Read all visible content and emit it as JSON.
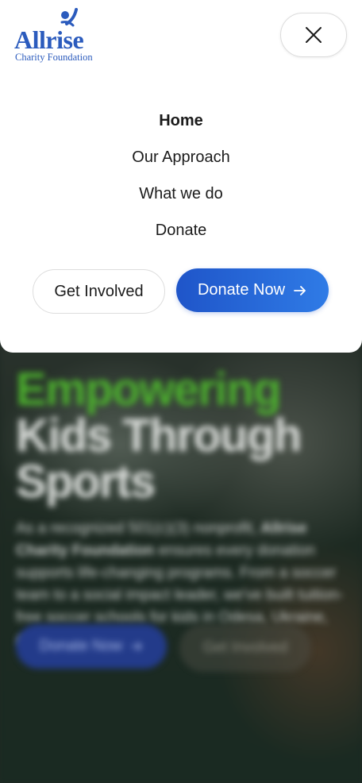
{
  "brand": {
    "name": "Allrise",
    "subtitle": "Charity Foundation",
    "color": "#2b5bbd"
  },
  "menu": {
    "close_icon": "close-icon",
    "items": [
      {
        "label": "Home",
        "active": true
      },
      {
        "label": "Our Approach",
        "active": false
      },
      {
        "label": "What we do",
        "active": false
      },
      {
        "label": "Donate",
        "active": false
      }
    ],
    "get_involved_label": "Get Involved",
    "donate_now_label": "Donate Now",
    "donate_icon": "arrow-right-icon",
    "accent_color": "#1f55c9"
  },
  "hero": {
    "title_accent": "Empowering",
    "title_rest": "Kids Through Sports",
    "text_intro": "As a recognized 501(c)(3) nonprofit,",
    "text_brand": "Allrise Charity Foundation",
    "text_body": "ensures every donation supports life-changing programs. From a soccer team to a social impact leader, we've built tuition-free soccer schools for kids in Odesa, Ukraine, and beyond.",
    "donate_label": "Donate Now",
    "involved_label": "Get Involved",
    "accent_color": "#4caf2e"
  }
}
